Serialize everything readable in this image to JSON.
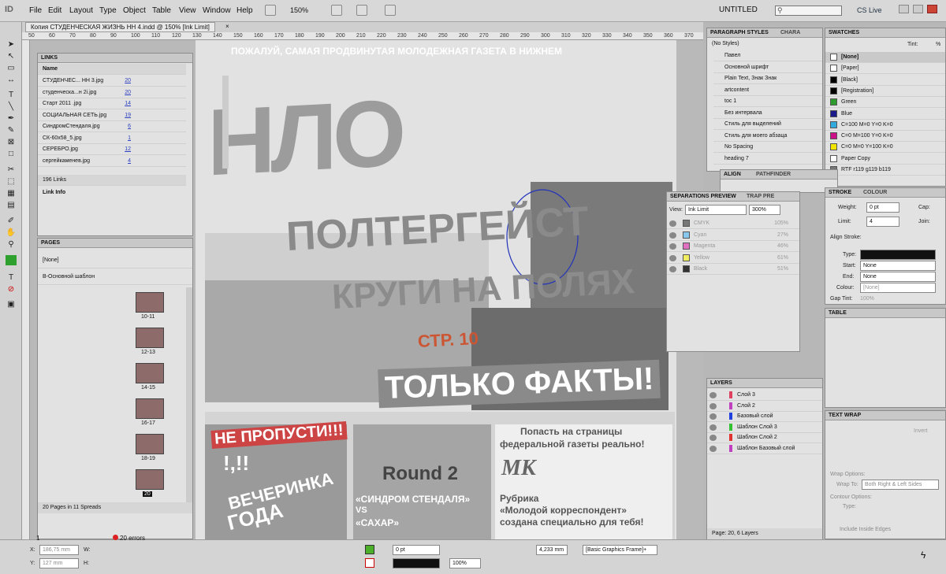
{
  "menu": {
    "items": [
      "File",
      "Edit",
      "Layout",
      "Type",
      "Object",
      "Table",
      "View",
      "Window",
      "Help"
    ],
    "zoom": "150%",
    "workspace": "UNTITLED",
    "cs_live": "CS Live"
  },
  "document": {
    "tab_title": "Копия СТУДЕНЧЕСКАЯ ЖИЗНЬ НН 4.indd @ 150% [Ink Limit]"
  },
  "ruler": {
    "ticks": [
      "50",
      "60",
      "70",
      "80",
      "90",
      "100",
      "110",
      "120",
      "130",
      "140",
      "150",
      "160",
      "170",
      "180",
      "190",
      "200",
      "210",
      "220",
      "230",
      "240",
      "250",
      "260",
      "270",
      "280",
      "290",
      "300",
      "310",
      "320",
      "330",
      "340",
      "350",
      "360",
      "370"
    ]
  },
  "links": {
    "title": "LINKS",
    "name_col": "Name",
    "items": [
      {
        "name": "СТУДЕНЧЕС... НН 3.jpg",
        "page": "20"
      },
      {
        "name": "студенческа...н 2i.jpg",
        "page": "20"
      },
      {
        "name": "Старт 2011 .jpg",
        "page": "14"
      },
      {
        "name": "СОЦИАЛЬНАЯ СЕТЬ.jpg",
        "page": "19"
      },
      {
        "name": "СиндромСтендаля.jpg",
        "page": "6"
      },
      {
        "name": "СК-60х58_5.jpg",
        "page": "1"
      },
      {
        "name": "СЕРЕБРО.jpg",
        "page": "12"
      },
      {
        "name": "сергейкаменев.jpg",
        "page": "4"
      }
    ],
    "count": "196 Links",
    "link_info": "Link Info"
  },
  "pages": {
    "title": "PAGES",
    "masters": [
      "[None]",
      "В-Основной шаблон"
    ],
    "spreads": [
      "10-11",
      "12-13",
      "14-15",
      "16-17",
      "18-19",
      "20"
    ],
    "summary": "20 Pages in 11 Spreads"
  },
  "paragraph_styles": {
    "title": "PARAGRAPH STYLES",
    "tab2": "CHARA",
    "current": "(No Styles)",
    "items": [
      "Павел",
      "Основной шрифт",
      "Plain Text, Знак Знак",
      "artcontent",
      "toc 1",
      "Без интервала",
      "Стиль для выделений",
      "Стиль для моего абзаца",
      "No Spacing",
      "heading 7"
    ]
  },
  "swatches": {
    "title": "SWATCHES",
    "tint_label": "Tint:",
    "tint_unit": "%",
    "items": [
      {
        "name": "[None]",
        "color": "#ffffff"
      },
      {
        "name": "[Paper]",
        "color": "#ffffff"
      },
      {
        "name": "[Black]",
        "color": "#000000"
      },
      {
        "name": "[Registration]",
        "color": "#000000"
      },
      {
        "name": "Green",
        "color": "#2e9b2e"
      },
      {
        "name": "Blue",
        "color": "#1a1a8a"
      },
      {
        "name": "C=100 M=0 Y=0 K=0",
        "color": "#33aadd"
      },
      {
        "name": "C=0 M=100 Y=0 K=0",
        "color": "#cc1188"
      },
      {
        "name": "C=0 M=0 Y=100 K=0",
        "color": "#f2e600"
      },
      {
        "name": "Paper Copy",
        "color": "#ffffff"
      },
      {
        "name": "RTF r119 g119 b119",
        "color": "#777777"
      }
    ]
  },
  "align": {
    "title": "ALIGN",
    "tab2": "PATHFINDER"
  },
  "separations": {
    "title": "SEPARATIONS PREVIEW",
    "tab2": "TRAP PRE",
    "view_label": "View:",
    "view_value": "Ink Limit",
    "zoom": "300%",
    "inks": [
      {
        "name": "CMYK",
        "pct": "105%",
        "color": "#777777"
      },
      {
        "name": "Cyan",
        "pct": "27%",
        "color": "#88c8ec"
      },
      {
        "name": "Magenta",
        "pct": "46%",
        "color": "#e070c0"
      },
      {
        "name": "Yellow",
        "pct": "61%",
        "color": "#f0ee60"
      },
      {
        "name": "Black",
        "pct": "51%",
        "color": "#333333"
      }
    ]
  },
  "stroke": {
    "title": "STROKE",
    "tab2": "COLOUR",
    "weight_label": "Weight:",
    "weight": "0 pt",
    "cap_label": "Cap:",
    "limit_label": "Limit:",
    "limit": "4",
    "join_label": "Join:",
    "align_label": "Align Stroke:",
    "type_label": "Type:",
    "start_label": "Start:",
    "start": "None",
    "end_label": "End:",
    "end": "None",
    "colour_label": "Colour:",
    "colour": "[None]",
    "tint_label": "Gap Tint:",
    "tint": "100%"
  },
  "table": {
    "title": "TABLE"
  },
  "text_wrap": {
    "title": "TEXT WRAP",
    "invert": "Invert",
    "wrap_options": "Wrap Options:",
    "wrap_to_label": "Wrap To:",
    "wrap_to": "Both Right & Left Sides",
    "contour": "Contour Options:",
    "type_label": "Type:",
    "inside": "Include Inside Edges"
  },
  "layers": {
    "title": "LAYERS",
    "items": [
      {
        "name": "Слой 3",
        "color": "#e04060"
      },
      {
        "name": "Слой 2",
        "color": "#c040c0"
      },
      {
        "name": "Базовый слой",
        "color": "#2040e0"
      },
      {
        "name": "Шаблон Слой 3",
        "color": "#30c030"
      },
      {
        "name": "Шаблон Слой 2",
        "color": "#e03030"
      },
      {
        "name": "Шаблон Базовый слой",
        "color": "#c040c0"
      }
    ],
    "summary": "Page: 20, 6 Layers"
  },
  "status": {
    "page": "1",
    "errors": "20 errors",
    "x_label": "X:",
    "x": "186,75 mm",
    "y_label": "Y:",
    "y": "127 mm",
    "w_label": "W:",
    "h_label": "H:",
    "stroke_pt": "0 pt",
    "opacity": "100%",
    "size": "4,233 mm",
    "frame": "[Basic Graphics Frame]+"
  },
  "newspaper": {
    "tagline": "ПОЖАЛУЙ, САМАЯ ПРОДВИНУТАЯ МОЛОДЕЖНАЯ ГАЗЕТА В НИЖНЕМ",
    "logo": "НЛО",
    "headline1": "ПОЛТЕРГЕЙСТ",
    "headline2": "КРУГИ НА ПОЛЯХ",
    "page_ref": "СТР. 10",
    "facts": "ТОЛЬКО ФАКТЫ!",
    "b1_title": "НЕ ПРОПУСТИ!!!",
    "b1_excl": "!,!!",
    "b1_sub1": "ВЕЧЕРИНКА",
    "b1_sub2": "ГОДА",
    "b2_round": "Round 2",
    "b2_t1": "«СИНДРОМ СТЕНДАЛЯ»",
    "b2_vs": "VS",
    "b2_t2": "«САХАР»",
    "b3_top1": "Попасть на страницы",
    "b3_top2": "федеральной газеты реально!",
    "b3_logo": "МК",
    "b3_rub": "Рубрика",
    "b3_r1": "«Молодой корреспондент»",
    "b3_r2": "создана специально для тебя!"
  }
}
